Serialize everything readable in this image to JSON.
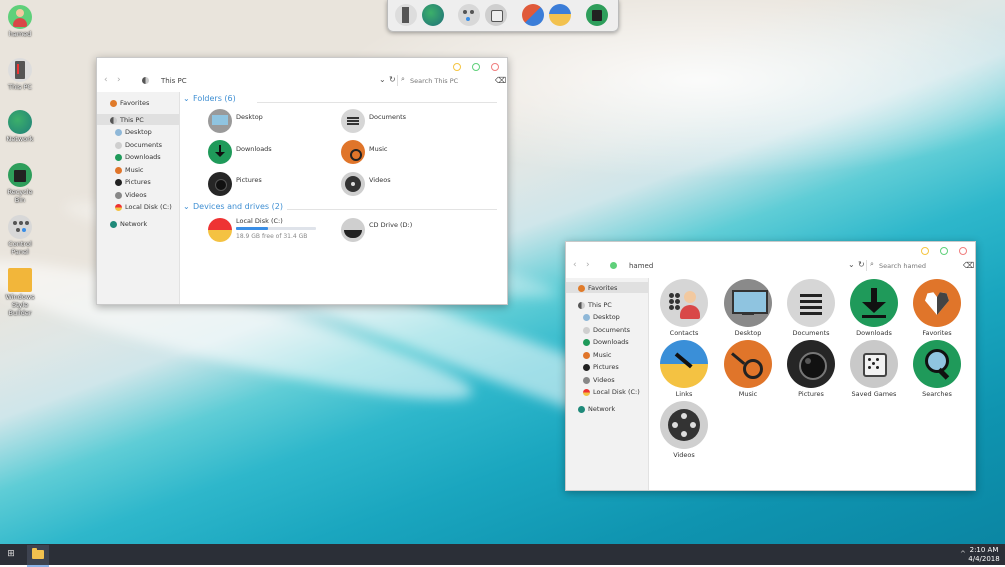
{
  "desktop_icons": [
    {
      "label": "hamed",
      "icon": "user-icon"
    },
    {
      "label": "This PC",
      "icon": "computer-icon"
    },
    {
      "label": "Network",
      "icon": "globe-icon"
    },
    {
      "label": "Recycle Bin",
      "icon": "recycle-bin-icon"
    },
    {
      "label": "Control Panel",
      "icon": "control-panel-icon"
    },
    {
      "label": "Windows Style Builder",
      "icon": "folder-icon"
    }
  ],
  "dock": {
    "items": [
      "this-pc-icon",
      "network-icon",
      "control-panel-icon",
      "games-icon",
      "paint-icon",
      "folder-icon",
      "recycle-bin-icon"
    ]
  },
  "window1": {
    "address": "This PC",
    "search_placeholder": "Search This PC",
    "nav": {
      "favorites": "Favorites",
      "this_pc": "This PC",
      "items": [
        "Desktop",
        "Documents",
        "Downloads",
        "Music",
        "Pictures",
        "Videos",
        "Local Disk (C:)"
      ],
      "network": "Network"
    },
    "folders_header": "Folders (6)",
    "folders": [
      {
        "label": "Desktop",
        "icon": "desktop-icon"
      },
      {
        "label": "Documents",
        "icon": "documents-icon"
      },
      {
        "label": "Downloads",
        "icon": "downloads-icon"
      },
      {
        "label": "Music",
        "icon": "music-icon"
      },
      {
        "label": "Pictures",
        "icon": "pictures-icon"
      },
      {
        "label": "Videos",
        "icon": "videos-icon"
      }
    ],
    "drives_header": "Devices and drives (2)",
    "drives": [
      {
        "label": "Local Disk (C:)",
        "free": "18.9 GB free of 31.4 GB",
        "used_fraction": 0.4
      },
      {
        "label": "CD Drive (D:)"
      }
    ]
  },
  "window2": {
    "address": "hamed",
    "search_placeholder": "Search hamed",
    "nav": {
      "favorites": "Favorites",
      "this_pc": "This PC",
      "items": [
        "Desktop",
        "Documents",
        "Downloads",
        "Music",
        "Pictures",
        "Videos",
        "Local Disk (C:)"
      ],
      "network": "Network"
    },
    "items": [
      {
        "label": "Contacts",
        "icon": "contacts-icon"
      },
      {
        "label": "Desktop",
        "icon": "desktop-icon"
      },
      {
        "label": "Documents",
        "icon": "documents-icon"
      },
      {
        "label": "Downloads",
        "icon": "downloads-icon"
      },
      {
        "label": "Favorites",
        "icon": "favorites-icon"
      },
      {
        "label": "Links",
        "icon": "links-icon"
      },
      {
        "label": "Music",
        "icon": "music-icon"
      },
      {
        "label": "Pictures",
        "icon": "pictures-icon"
      },
      {
        "label": "Saved Games",
        "icon": "saved-games-icon"
      },
      {
        "label": "Searches",
        "icon": "searches-icon"
      },
      {
        "label": "Videos",
        "icon": "videos-icon"
      }
    ]
  },
  "taskbar": {
    "time": "2:10 AM",
    "date": "4/4/2018"
  },
  "colors": {
    "accent": "#3a8ee6",
    "close": "#f07e7e",
    "minimize": "#f5c542",
    "maximize": "#5fd07a"
  }
}
